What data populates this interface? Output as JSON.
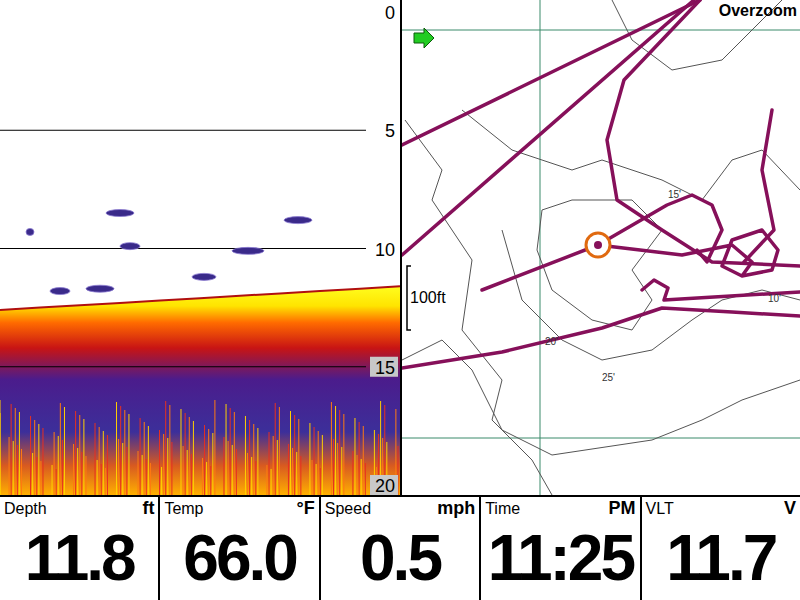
{
  "sonar": {
    "depth_scale": {
      "ticks": [
        "0",
        "5",
        "10",
        "15",
        "20"
      ],
      "max": 20
    },
    "bottom_profile": [
      12.6,
      12.5,
      12.4,
      12.3,
      12.2,
      12.1,
      12.0,
      11.9,
      11.8,
      11.7,
      11.6
    ],
    "fish": [
      {
        "ping": 30,
        "depth": 8.5,
        "length": 7
      },
      {
        "ping": 74.5,
        "depth": 8.8,
        "length": 7
      },
      {
        "ping": 32.5,
        "depth": 9.9,
        "length": 5
      },
      {
        "ping": 62,
        "depth": 10.1,
        "length": 8
      },
      {
        "ping": 51,
        "depth": 11.2,
        "length": 6
      },
      {
        "ping": 15,
        "depth": 11.8,
        "length": 5
      },
      {
        "ping": 25,
        "depth": 11.7,
        "length": 7
      },
      {
        "ping": 7.5,
        "depth": 9.3,
        "length": 2
      }
    ]
  },
  "map": {
    "mode": "Overzoom",
    "scale": "100ft",
    "contour_labels": [
      "15'",
      "10'",
      "20'",
      "25'"
    ]
  },
  "readouts": [
    {
      "label": "Depth",
      "unit": "ft",
      "value": "11.8"
    },
    {
      "label": "Temp",
      "unit": "°F",
      "value": "66.0"
    },
    {
      "label": "Speed",
      "unit": "mph",
      "value": "0.5"
    },
    {
      "label": "Time",
      "unit": "PM",
      "value": "11:25"
    },
    {
      "label": "VLT",
      "unit": "V",
      "value": "11.7"
    }
  ]
}
